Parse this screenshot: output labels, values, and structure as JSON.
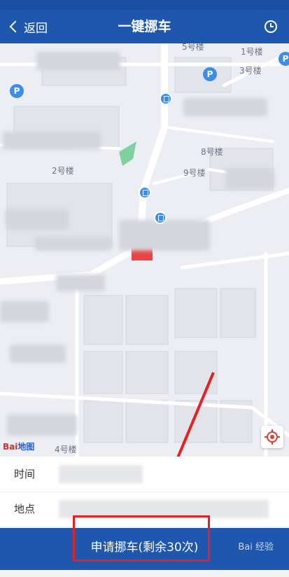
{
  "header": {
    "back_label": "返回",
    "title": "一键挪车"
  },
  "map": {
    "labels": {
      "building1": "1号楼",
      "building2": "2号楼",
      "building3": "3号楼",
      "building4": "4号楼",
      "building8": "8号楼",
      "building9": "9号楼",
      "building5": "5号楼"
    },
    "parking_glyph": "P",
    "baidu_logo": {
      "text_red": "Bai",
      "text_blue": "地图"
    }
  },
  "info": {
    "time_label": "时间",
    "location_label": "地点"
  },
  "apply_button": {
    "label": "申请挪车(剩余30次)"
  },
  "watermark": "Bai 经验",
  "colors": {
    "primary": "#1e57ad",
    "annotation_red": "#e62020",
    "map_bg": "#eceef3"
  }
}
